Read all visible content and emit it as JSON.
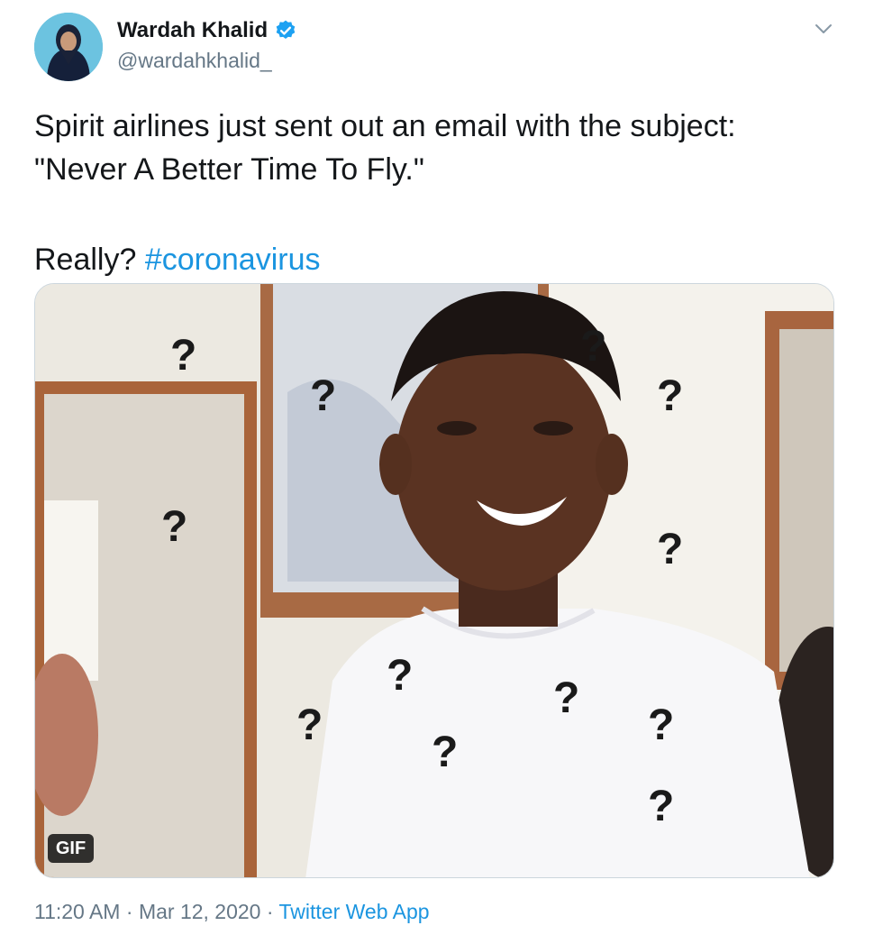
{
  "author": {
    "name": "Wardah Khalid",
    "handle": "@wardahkhalid_",
    "verified": true
  },
  "tweet": {
    "lines": [
      "Spirit airlines just sent out an email with the subject:",
      "\"Never A Better Time To Fly.\""
    ],
    "reply_text": "Really? ",
    "hashtag": "#coronavirus"
  },
  "media": {
    "type": "gif",
    "badge": "GIF",
    "overlay_glyph": "?"
  },
  "meta": {
    "time": "11:20 AM",
    "separator": " · ",
    "date": "Mar 12, 2020",
    "source": "Twitter Web App"
  },
  "colors": {
    "link": "#1b95e0",
    "verified": "#1da1f2",
    "secondary_text": "#657786"
  },
  "icons": {
    "verified": "verified-badge-icon",
    "more": "chevron-down-icon"
  }
}
